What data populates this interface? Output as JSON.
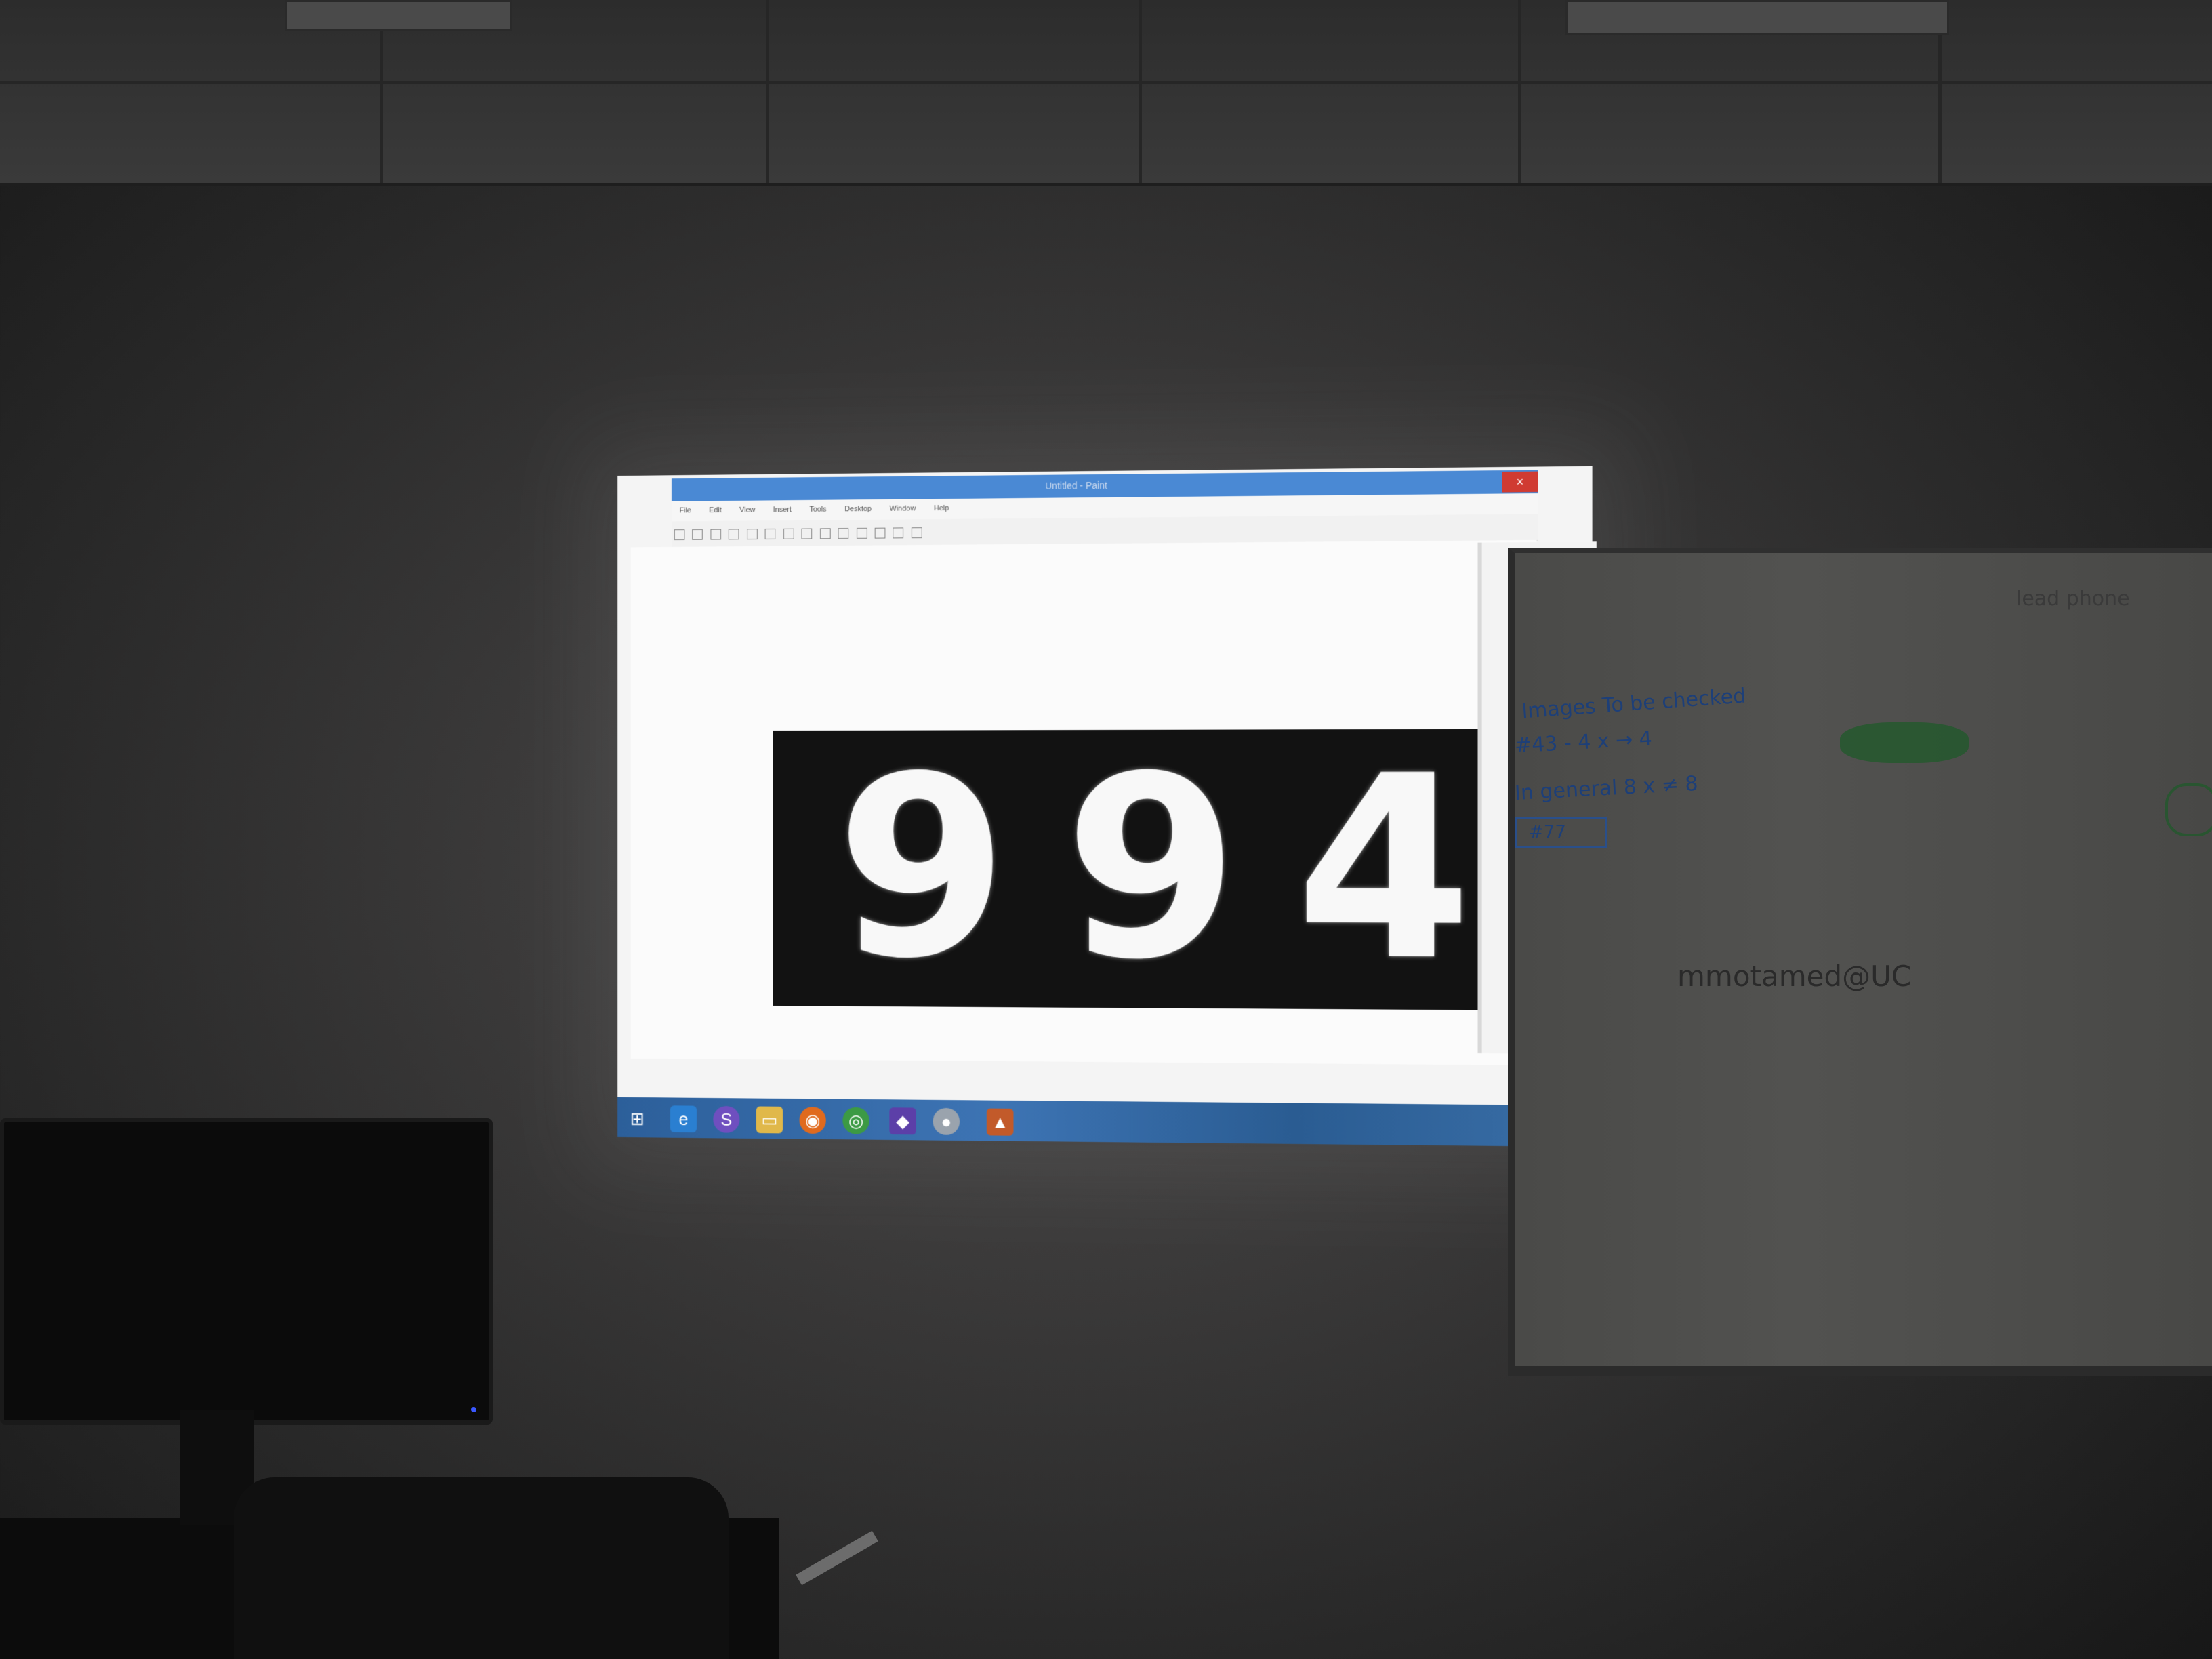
{
  "screen": {
    "window_title": "Untitled - Paint",
    "menu_items": [
      "File",
      "Edit",
      "View",
      "Insert",
      "Tools",
      "Desktop",
      "Window",
      "Help"
    ],
    "close_symbol": "×",
    "digits": [
      "9",
      "9",
      "4"
    ]
  },
  "taskbar": {
    "icons": [
      "windows-start-icon",
      "internet-explorer-icon",
      "skype-icon",
      "file-explorer-icon",
      "firefox-icon",
      "chrome-icon",
      "visual-studio-icon",
      "app-icon",
      "matlab-icon"
    ]
  },
  "whiteboard": {
    "line1": "Images To be checked",
    "line2": "#43 - 4 x → 4",
    "line3": "In general 8 x ≠ 8",
    "box_text": "#77",
    "email": "mmotamed@UC",
    "top_right": "lead phone"
  }
}
